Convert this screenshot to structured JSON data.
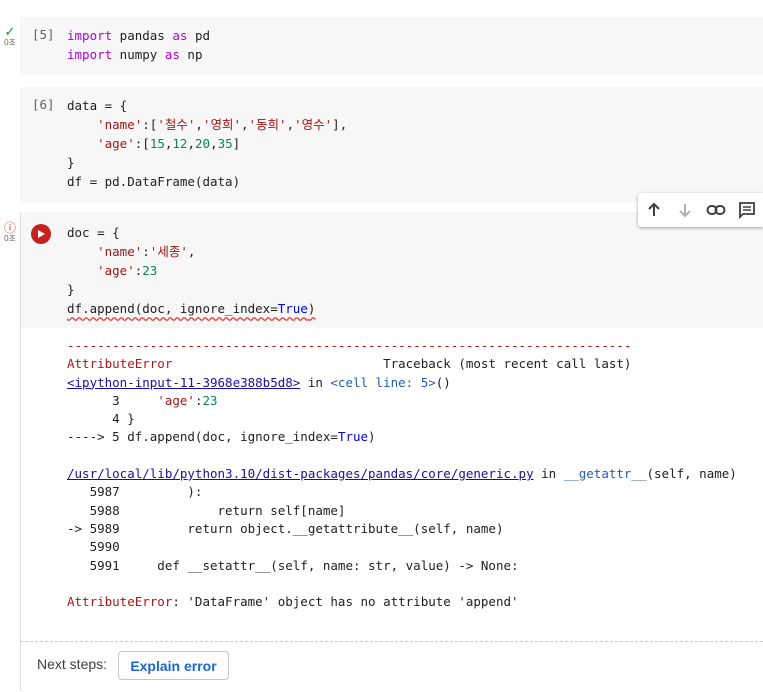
{
  "cells": [
    {
      "count": "[5]",
      "status": "ok",
      "time": "0초",
      "lines": [
        [
          [
            "kw",
            "import"
          ],
          [
            "t",
            " pandas "
          ],
          [
            "kw",
            "as"
          ],
          [
            "t",
            " pd"
          ]
        ],
        [
          [
            "kw",
            "import"
          ],
          [
            "t",
            " numpy "
          ],
          [
            "kw",
            "as"
          ],
          [
            "t",
            " np"
          ]
        ]
      ]
    },
    {
      "count": "[6]",
      "lines": [
        [
          [
            "t",
            "data = {"
          ]
        ],
        [
          [
            "t",
            "    "
          ],
          [
            "str",
            "'name'"
          ],
          [
            "t",
            ":["
          ],
          [
            "str",
            "'철수'"
          ],
          [
            "t",
            ","
          ],
          [
            "str",
            "'영희'"
          ],
          [
            "t",
            ","
          ],
          [
            "str",
            "'동희'"
          ],
          [
            "t",
            ","
          ],
          [
            "str",
            "'영수'"
          ],
          [
            "t",
            "],"
          ]
        ],
        [
          [
            "t",
            "    "
          ],
          [
            "str",
            "'age'"
          ],
          [
            "t",
            ":["
          ],
          [
            "num",
            "15"
          ],
          [
            "t",
            ","
          ],
          [
            "num",
            "12"
          ],
          [
            "t",
            ","
          ],
          [
            "num",
            "20"
          ],
          [
            "t",
            ","
          ],
          [
            "num",
            "35"
          ],
          [
            "t",
            "]"
          ]
        ],
        [
          [
            "t",
            "}"
          ]
        ],
        [
          [
            "t",
            "df = pd.DataFrame(data)"
          ]
        ]
      ]
    },
    {
      "status": "error",
      "time": "0초",
      "lines": [
        [
          [
            "t",
            "doc = {"
          ]
        ],
        [
          [
            "t",
            "    "
          ],
          [
            "str",
            "'name'"
          ],
          [
            "t",
            ":"
          ],
          [
            "str",
            "'세종'"
          ],
          [
            "t",
            ","
          ]
        ],
        [
          [
            "t",
            "    "
          ],
          [
            "str",
            "'age'"
          ],
          [
            "t",
            ":"
          ],
          [
            "num",
            "23"
          ]
        ],
        [
          [
            "t",
            "}"
          ]
        ],
        [
          [
            "sq",
            "df.append(doc, ignore_index="
          ],
          [
            "sqbool",
            "True"
          ],
          [
            "sq",
            ")"
          ]
        ]
      ]
    }
  ],
  "toolbar": {
    "icons": [
      "arrow-up-icon",
      "arrow-down-icon",
      "link-icon",
      "comment-icon"
    ]
  },
  "output": {
    "lines": [
      [
        [
          "err",
          "---------------------------------------------------------------------------"
        ]
      ],
      [
        [
          "err",
          "AttributeError"
        ],
        [
          "t",
          "                            Traceback (most recent call last)"
        ]
      ],
      [
        [
          "link",
          "<ipython-input-11-3968e388b5d8>"
        ],
        [
          "t",
          " in "
        ],
        [
          "blue",
          "<cell line: 5>"
        ],
        [
          "t",
          "()"
        ]
      ],
      [
        [
          "t",
          "      3     "
        ],
        [
          "str",
          "'age'"
        ],
        [
          "t",
          ":"
        ],
        [
          "num",
          "23"
        ]
      ],
      [
        [
          "t",
          "      4 }"
        ]
      ],
      [
        [
          "t",
          "----> 5 df.append(doc, ignore_index="
        ],
        [
          "bool",
          "True"
        ],
        [
          "t",
          ")"
        ]
      ],
      [
        [
          "t",
          ""
        ]
      ],
      [
        [
          "link",
          "/usr/local/lib/python3.10/dist-packages/pandas/core/generic.py"
        ],
        [
          "t",
          " in "
        ],
        [
          "blue",
          "__getattr__"
        ],
        [
          "t",
          "(self, name)"
        ]
      ],
      [
        [
          "t",
          "   5987         ):"
        ]
      ],
      [
        [
          "t",
          "   5988             return self[name]"
        ]
      ],
      [
        [
          "t",
          "-> 5989         return object.__getattribute__(self, name)"
        ]
      ],
      [
        [
          "t",
          "   5990"
        ]
      ],
      [
        [
          "t",
          "   5991     def __setattr__(self, name: str, value) -> None:"
        ]
      ],
      [
        [
          "t",
          ""
        ]
      ],
      [
        [
          "err",
          "AttributeError"
        ],
        [
          "t",
          ": 'DataFrame' object has no attribute 'append'"
        ]
      ]
    ]
  },
  "next_steps": {
    "label": "Next steps:",
    "button": "Explain error"
  }
}
